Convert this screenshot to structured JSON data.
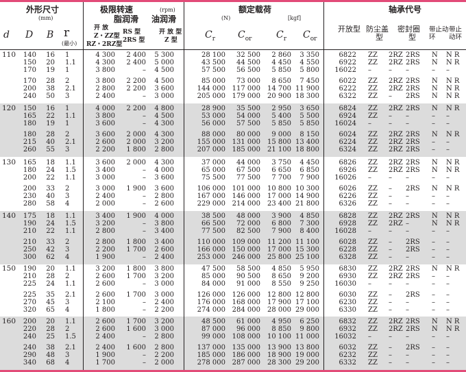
{
  "headers": {
    "dim": "外形尺寸",
    "dim_unit": "(mm)",
    "speed": "极限转速",
    "speed_unit": "(rpm)",
    "grease": "脂润滑",
    "oil": "油润滑",
    "open": "开 放",
    "open2": "开 放 型",
    "zzrs": "RS 型",
    "zz_type": "Z・ZZ型",
    "rs2": "2RS 型",
    "rz2": "RZ・2RZ型",
    "z_type": "Z 型",
    "load": "额定载荷",
    "n": "(N)",
    "kgf": "[kgf]",
    "code": "轴承代号",
    "d": "d",
    "D": "D",
    "B": "B",
    "r": "r",
    "rmin": "(最小)",
    "Cr": "C",
    "Cr_sub": "r",
    "Cor": "C",
    "Cor_sub": "or",
    "c_open": "开放型",
    "c_dust": "防尘盖",
    "c_dust2": "型",
    "c_seal": "密封圈",
    "c_seal2": "型",
    "c_snap": "带止动",
    "c_snap2": "环",
    "c_snapb": "带止",
    "c_snapb2": "动环"
  },
  "groups": [
    {
      "d": "110",
      "rows": [
        [
          "140",
          "16",
          "1",
          "4 300",
          "2 400",
          "5 300",
          "28 100",
          "32 500",
          "2 860",
          "3 350",
          "6822",
          "ZZ",
          "2RZ",
          "2RS",
          "N",
          "N R"
        ],
        [
          "150",
          "20",
          "1.1",
          "4 300",
          "2 400",
          "5 000",
          "43 500",
          "44 500",
          "4 450",
          "4 550",
          "6922",
          "ZZ",
          "2RZ",
          "2RS",
          "N",
          "N R"
        ],
        [
          "170",
          "19",
          "1",
          "3 800",
          "–",
          "4 500",
          "57 500",
          "56 500",
          "5 850",
          "5 800",
          "16022",
          "–",
          "–",
          "–",
          "–",
          "–"
        ],
        [
          "170",
          "28",
          "2",
          "3 800",
          "2 200",
          "4 500",
          "85 000",
          "73 000",
          "8 650",
          "7 450",
          "6022",
          "ZZ",
          "2RZ",
          "2RS",
          "N",
          "N R"
        ],
        [
          "200",
          "38",
          "2.1",
          "2 800",
          "2 200",
          "3 600",
          "144 000",
          "117 000",
          "14 700",
          "11 900",
          "6222",
          "ZZ",
          "2RZ",
          "2RS",
          "N",
          "N R"
        ],
        [
          "240",
          "50",
          "3",
          "2 400",
          "–",
          "3 000",
          "205 000",
          "179 000",
          "20 900",
          "18 300",
          "6322",
          "ZZ",
          "–",
          "2RS",
          "N",
          "N R"
        ]
      ]
    },
    {
      "d": "120",
      "rows": [
        [
          "150",
          "16",
          "1",
          "4 000",
          "2 200",
          "4 800",
          "28 900",
          "35 500",
          "2 950",
          "3 650",
          "6824",
          "ZZ",
          "2RZ",
          "2RS",
          "N",
          "N R"
        ],
        [
          "165",
          "22",
          "1.1",
          "3 800",
          "–",
          "4 500",
          "53 000",
          "54 000",
          "5 400",
          "5 500",
          "6924",
          "ZZ",
          "–",
          "–",
          "–",
          "–"
        ],
        [
          "180",
          "19",
          "1",
          "3 600",
          "–",
          "4 300",
          "56 000",
          "57 500",
          "5 850",
          "5 850",
          "16024",
          "–",
          "–",
          "–",
          "–",
          "–"
        ],
        [
          "180",
          "28",
          "2",
          "3 600",
          "2 000",
          "4 300",
          "88 000",
          "80 000",
          "9 000",
          "8 150",
          "6024",
          "ZZ",
          "2RZ",
          "2RS",
          "N",
          "N R"
        ],
        [
          "215",
          "40",
          "2.1",
          "2 600",
          "2 000",
          "3 200",
          "155 000",
          "131 000",
          "15 800",
          "13 400",
          "6224",
          "ZZ",
          "2RZ",
          "2RS",
          "–",
          "–"
        ],
        [
          "260",
          "55",
          "3",
          "2 200",
          "1 800",
          "2 800",
          "207 000",
          "185 000",
          "21 100",
          "18 800",
          "6324",
          "ZZ",
          "2RZ",
          "2RS",
          "–",
          "–"
        ]
      ]
    },
    {
      "d": "130",
      "rows": [
        [
          "165",
          "18",
          "1.1",
          "3 600",
          "2 000",
          "4 300",
          "37 000",
          "44 000",
          "3 750",
          "4 450",
          "6826",
          "ZZ",
          "2RZ",
          "2RS",
          "N",
          "N R"
        ],
        [
          "180",
          "24",
          "1.5",
          "3 400",
          "–",
          "4 000",
          "65 000",
          "67 500",
          "6 650",
          "6 850",
          "6926",
          "ZZ",
          "2RZ",
          "2RS",
          "N",
          "N R"
        ],
        [
          "200",
          "22",
          "1.1",
          "3 000",
          "–",
          "3 600",
          "75 500",
          "77 500",
          "7 700",
          "7 900",
          "16026",
          "–",
          "–",
          "–",
          "–",
          "–"
        ],
        [
          "200",
          "33",
          "2",
          "3 000",
          "1 900",
          "3 600",
          "106 000",
          "101 000",
          "10 800",
          "10 300",
          "6026",
          "ZZ",
          "–",
          "2RS",
          "N",
          "N R"
        ],
        [
          "230",
          "40",
          "3",
          "2 400",
          "–",
          "2 800",
          "167 000",
          "146 000",
          "17 000",
          "14 900",
          "6226",
          "ZZ",
          "–",
          "–",
          "–",
          "–"
        ],
        [
          "280",
          "58",
          "4",
          "2 000",
          "–",
          "2 600",
          "229 000",
          "214 000",
          "23 400",
          "21 800",
          "6326",
          "ZZ",
          "–",
          "–",
          "–",
          "–"
        ]
      ]
    },
    {
      "d": "140",
      "rows": [
        [
          "175",
          "18",
          "1.1",
          "3 400",
          "1 900",
          "4 000",
          "38 500",
          "48 000",
          "3 900",
          "4 850",
          "6828",
          "ZZ",
          "2RZ",
          "2RS",
          "N",
          "N R"
        ],
        [
          "190",
          "24",
          "1.5",
          "3 200",
          "–",
          "3 800",
          "66 500",
          "72 000",
          "6 800",
          "7 300",
          "6928",
          "ZZ",
          "2RZ",
          "–",
          "N",
          "N R"
        ],
        [
          "210",
          "22",
          "1.1",
          "2 800",
          "–",
          "3 400",
          "77 500",
          "82 500",
          "7 900",
          "8 400",
          "16028",
          "–",
          "–",
          "–",
          "–",
          "–"
        ],
        [
          "210",
          "33",
          "2",
          "2 800",
          "1 800",
          "3 400",
          "110 000",
          "109 000",
          "11 200",
          "11 100",
          "6028",
          "ZZ",
          "–",
          "2RS",
          "–",
          "–"
        ],
        [
          "250",
          "42",
          "3",
          "2 200",
          "1 700",
          "2 600",
          "166 000",
          "150 000",
          "17 000",
          "15 300",
          "6228",
          "ZZ",
          "–",
          "2RS",
          "–",
          "–"
        ],
        [
          "300",
          "62",
          "4",
          "1 900",
          "–",
          "2 400",
          "253 000",
          "246 000",
          "25 800",
          "25 100",
          "6328",
          "ZZ",
          "–",
          "–",
          "–",
          "–"
        ]
      ]
    },
    {
      "d": "150",
      "rows": [
        [
          "190",
          "20",
          "1.1",
          "3 200",
          "1 800",
          "3 800",
          "47 500",
          "58 500",
          "4 850",
          "5 950",
          "6830",
          "ZZ",
          "2RZ",
          "2RS",
          "N",
          "N R"
        ],
        [
          "210",
          "28",
          "2",
          "2 600",
          "1 700",
          "3 200",
          "85 000",
          "90 500",
          "8 650",
          "9 200",
          "6930",
          "ZZ",
          "2RZ",
          "2RS",
          "–",
          "–"
        ],
        [
          "225",
          "24",
          "1.1",
          "2 600",
          "–",
          "3 000",
          "84 000",
          "91 000",
          "8 550",
          "9 250",
          "16030",
          "–",
          "–",
          "–",
          "–",
          "–"
        ],
        [
          "225",
          "35",
          "2.1",
          "2 600",
          "1 700",
          "3 000",
          "126 000",
          "126 000",
          "12 800",
          "12 800",
          "6030",
          "ZZ",
          "–",
          "2RS",
          "–",
          "–"
        ],
        [
          "270",
          "45",
          "3",
          "2 100",
          "–",
          "2 400",
          "176 000",
          "168 000",
          "17 900",
          "17 100",
          "6230",
          "ZZ",
          "–",
          "–",
          "–",
          "–"
        ],
        [
          "320",
          "65",
          "4",
          "1 800",
          "–",
          "2 200",
          "274 000",
          "284 000",
          "28 000",
          "29 000",
          "6330",
          "ZZ",
          "–",
          "–",
          "–",
          "–"
        ]
      ]
    },
    {
      "d": "160",
      "rows": [
        [
          "200",
          "20",
          "1.1",
          "2 600",
          "1 700",
          "3 200",
          "48 500",
          "61 000",
          "4 950",
          "6 250",
          "6832",
          "ZZ",
          "2RZ",
          "2RS",
          "N",
          "N R"
        ],
        [
          "220",
          "28",
          "2",
          "2 600",
          "1 600",
          "3 000",
          "87 000",
          "96 000",
          "8 850",
          "9 800",
          "6932",
          "ZZ",
          "2RZ",
          "2RS",
          "N",
          "N R"
        ],
        [
          "240",
          "25",
          "1.5",
          "2 400",
          "–",
          "2 800",
          "99 000",
          "108 000",
          "10 100",
          "11 000",
          "16032",
          "–",
          "–",
          "–",
          "–",
          "–"
        ],
        [
          "240",
          "38",
          "2.1",
          "2 400",
          "1 600",
          "2 800",
          "137 000",
          "135 000",
          "13 900",
          "13 800",
          "6032",
          "ZZ",
          "–",
          "2RS",
          "–",
          "–"
        ],
        [
          "290",
          "48",
          "3",
          "1 900",
          "–",
          "2 200",
          "185 000",
          "186 000",
          "18 900",
          "19 000",
          "6232",
          "ZZ",
          "–",
          "–",
          "–",
          "–"
        ],
        [
          "340",
          "68",
          "4",
          "1 700",
          "–",
          "2 000",
          "278 000",
          "287 000",
          "28 300",
          "29 200",
          "6332",
          "ZZ",
          "–",
          "–",
          "–",
          "–"
        ]
      ]
    }
  ],
  "colors": {
    "accent": "#e24b78",
    "band": "#dcdcdc",
    "text": "#231f20"
  }
}
